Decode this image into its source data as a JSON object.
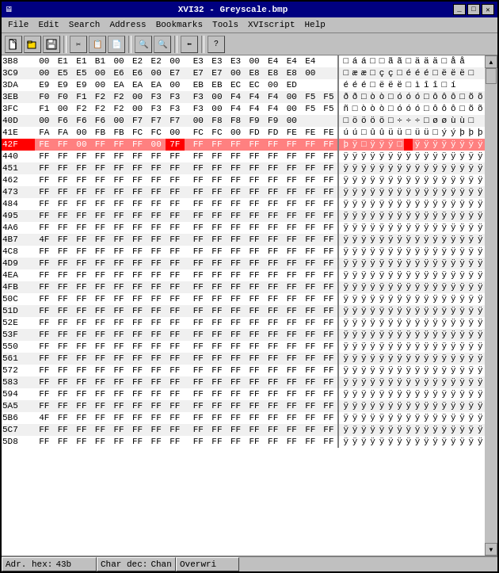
{
  "title": "XVI32 - Greyscale.bmp",
  "titleButtons": [
    "_",
    "□",
    "✕"
  ],
  "menu": [
    "File",
    "Edit",
    "Search",
    "Address",
    "Bookmarks",
    "Tools",
    "XVIscript",
    "Help"
  ],
  "toolbar": {
    "buttons": [
      "📄",
      "📂",
      "💾",
      "✂",
      "📋",
      "📄",
      "🔍",
      "🔍",
      "⬅",
      "?"
    ]
  },
  "rows": [
    {
      "addr": "3B8",
      "hex": [
        "00",
        "E1",
        "E1",
        "B1",
        "00",
        "E2",
        "E2",
        "00",
        "E3",
        "E3",
        "E3",
        "00",
        "E4",
        "E4",
        "E4"
      ],
      "chars": "□áá□□ãã□äää□åå"
    },
    {
      "addr": "3C9",
      "hex": [
        "00",
        "E5",
        "E5",
        "00",
        "E6",
        "E6",
        "00",
        "E7",
        "E7",
        "E7",
        "00",
        "E8",
        "E8",
        "E8",
        "00"
      ],
      "chars": "□ææ□çç□ééé□ëëë□"
    },
    {
      "addr": "3DA",
      "hex": [
        "E9",
        "E9",
        "E9",
        "00",
        "EA",
        "EA",
        "EA",
        "00",
        "EB",
        "EB",
        "EC",
        "EC",
        "00",
        "ED"
      ],
      "chars": "ééé□ëëë□ìîî□í"
    },
    {
      "addr": "3EB",
      "hex": [
        "F0",
        "F0",
        "F1",
        "F2",
        "F2",
        "00",
        "F3",
        "F3",
        "F3",
        "00",
        "F4",
        "F4",
        "F4",
        "00",
        "F5",
        "F5"
      ],
      "chars": "ðð□òò□óóó□ôôô□õõ"
    },
    {
      "addr": "3FC",
      "hex": [
        "F1",
        "00",
        "F2",
        "F2",
        "F2",
        "00",
        "F3",
        "F3",
        "F3",
        "00",
        "F4",
        "F4",
        "F4",
        "00",
        "F5",
        "F5"
      ],
      "chars": "ñ□òòò□óóó□ôôô□õõ"
    },
    {
      "addr": "40D",
      "hex": [
        "00",
        "F6",
        "F6",
        "F6",
        "00",
        "F7",
        "F7",
        "F7",
        "00",
        "F8",
        "F8",
        "F9",
        "F9",
        "00"
      ],
      "chars": "□öööö□÷÷÷□øøùù□"
    },
    {
      "addr": "41E",
      "hex": [
        "FA",
        "FA",
        "00",
        "FB",
        "FB",
        "FC",
        "FC",
        "00",
        "FC",
        "FC",
        "00",
        "FD",
        "FD",
        "FE",
        "FE",
        "FE"
      ],
      "chars": "úú□ûûüü□üü□ýýþþþ"
    },
    {
      "addr": "42F",
      "hex": [
        "FE",
        "FF",
        "00",
        "FF",
        "FF",
        "FF",
        "00",
        "7F",
        "FF",
        "FF",
        "FF",
        "FF",
        "FF",
        "FF",
        "FF",
        "FF"
      ],
      "chars": "þÿ□ÿÿÿ□ÿÿÿÿÿÿÿÿ",
      "highlight": true,
      "redCell": 7
    },
    {
      "addr": "440",
      "hex": [
        "FF",
        "FF",
        "FF",
        "FF",
        "FF",
        "FF",
        "FF",
        "FF",
        "FF",
        "FF",
        "FF",
        "FF",
        "FF",
        "FF",
        "FF",
        "FF"
      ],
      "chars": "ÿÿÿÿÿÿÿÿÿÿÿÿÿÿÿÿ"
    },
    {
      "addr": "451",
      "hex": [
        "FF",
        "FF",
        "FF",
        "FF",
        "FF",
        "FF",
        "FF",
        "FF",
        "FF",
        "FF",
        "FF",
        "FF",
        "FF",
        "FF",
        "FF",
        "FF"
      ],
      "chars": "ÿÿÿÿÿÿÿÿÿÿÿÿÿÿÿÿ"
    },
    {
      "addr": "462",
      "hex": [
        "FF",
        "FF",
        "FF",
        "FF",
        "FF",
        "FF",
        "FF",
        "FF",
        "FF",
        "FF",
        "FF",
        "FF",
        "FF",
        "FF",
        "FF",
        "FF"
      ],
      "chars": "ÿÿÿÿÿÿÿÿÿÿÿÿÿÿÿÿ"
    },
    {
      "addr": "473",
      "hex": [
        "FF",
        "FF",
        "FF",
        "FF",
        "FF",
        "FF",
        "FF",
        "FF",
        "FF",
        "FF",
        "FF",
        "FF",
        "FF",
        "FF",
        "FF",
        "FF"
      ],
      "chars": "ÿÿÿÿÿÿÿÿÿÿÿÿÿÿÿÿ"
    },
    {
      "addr": "484",
      "hex": [
        "FF",
        "FF",
        "FF",
        "FF",
        "FF",
        "FF",
        "FF",
        "FF",
        "FF",
        "FF",
        "FF",
        "FF",
        "FF",
        "FF",
        "FF",
        "FF"
      ],
      "chars": "ÿÿÿÿÿÿÿÿÿÿÿÿÿÿÿÿ"
    },
    {
      "addr": "495",
      "hex": [
        "FF",
        "FF",
        "FF",
        "FF",
        "FF",
        "FF",
        "FF",
        "FF",
        "FF",
        "FF",
        "FF",
        "FF",
        "FF",
        "FF",
        "FF",
        "FF"
      ],
      "chars": "ÿÿÿÿÿÿÿÿÿÿÿÿÿÿÿÿ"
    },
    {
      "addr": "4A6",
      "hex": [
        "FF",
        "FF",
        "FF",
        "FF",
        "FF",
        "FF",
        "FF",
        "FF",
        "FF",
        "FF",
        "FF",
        "FF",
        "FF",
        "FF",
        "FF",
        "FF"
      ],
      "chars": "ÿÿÿÿÿÿÿÿÿÿÿÿÿÿÿÿ"
    },
    {
      "addr": "4B7",
      "hex": [
        "4F",
        "FF",
        "FF",
        "FF",
        "FF",
        "FF",
        "FF",
        "FF",
        "FF",
        "FF",
        "FF",
        "FF",
        "FF",
        "FF",
        "FF",
        "FF"
      ],
      "chars": "ÿÿÿÿÿÿÿÿÿÿÿÿÿÿÿÿ"
    },
    {
      "addr": "4C8",
      "hex": [
        "FF",
        "FF",
        "FF",
        "FF",
        "FF",
        "FF",
        "FF",
        "FF",
        "FF",
        "FF",
        "FF",
        "FF",
        "FF",
        "FF",
        "FF",
        "FF"
      ],
      "chars": "ÿÿÿÿÿÿÿÿÿÿÿÿÿÿÿÿ"
    },
    {
      "addr": "4D9",
      "hex": [
        "FF",
        "FF",
        "FF",
        "FF",
        "FF",
        "FF",
        "FF",
        "FF",
        "FF",
        "FF",
        "FF",
        "FF",
        "FF",
        "FF",
        "FF",
        "FF"
      ],
      "chars": "ÿÿÿÿÿÿÿÿÿÿÿÿÿÿÿÿ"
    },
    {
      "addr": "4EA",
      "hex": [
        "FF",
        "FF",
        "FF",
        "FF",
        "FF",
        "FF",
        "FF",
        "FF",
        "FF",
        "FF",
        "FF",
        "FF",
        "FF",
        "FF",
        "FF",
        "FF"
      ],
      "chars": "ÿÿÿÿÿÿÿÿÿÿÿÿÿÿÿÿ"
    },
    {
      "addr": "4FB",
      "hex": [
        "FF",
        "FF",
        "FF",
        "FF",
        "FF",
        "FF",
        "FF",
        "FF",
        "FF",
        "FF",
        "FF",
        "FF",
        "FF",
        "FF",
        "FF",
        "FF"
      ],
      "chars": "ÿÿÿÿÿÿÿÿÿÿÿÿÿÿÿÿ"
    },
    {
      "addr": "50C",
      "hex": [
        "FF",
        "FF",
        "FF",
        "FF",
        "FF",
        "FF",
        "FF",
        "FF",
        "FF",
        "FF",
        "FF",
        "FF",
        "FF",
        "FF",
        "FF",
        "FF"
      ],
      "chars": "ÿÿÿÿÿÿÿÿÿÿÿÿÿÿÿÿ"
    },
    {
      "addr": "51D",
      "hex": [
        "FF",
        "FF",
        "FF",
        "FF",
        "FF",
        "FF",
        "FF",
        "FF",
        "FF",
        "FF",
        "FF",
        "FF",
        "FF",
        "FF",
        "FF",
        "FF"
      ],
      "chars": "ÿÿÿÿÿÿÿÿÿÿÿÿÿÿÿÿ"
    },
    {
      "addr": "52E",
      "hex": [
        "FF",
        "FF",
        "FF",
        "FF",
        "FF",
        "FF",
        "FF",
        "FF",
        "FF",
        "FF",
        "FF",
        "FF",
        "FF",
        "FF",
        "FF",
        "FF"
      ],
      "chars": "ÿÿÿÿÿÿÿÿÿÿÿÿÿÿÿÿ"
    },
    {
      "addr": "53F",
      "hex": [
        "FF",
        "FF",
        "FF",
        "FF",
        "FF",
        "FF",
        "FF",
        "FF",
        "FF",
        "FF",
        "FF",
        "FF",
        "FF",
        "FF",
        "FF",
        "FF"
      ],
      "chars": "ÿÿÿÿÿÿÿÿÿÿÿÿÿÿÿÿ"
    },
    {
      "addr": "550",
      "hex": [
        "FF",
        "FF",
        "FF",
        "FF",
        "FF",
        "FF",
        "FF",
        "FF",
        "FF",
        "FF",
        "FF",
        "FF",
        "FF",
        "FF",
        "FF",
        "FF"
      ],
      "chars": "ÿÿÿÿÿÿÿÿÿÿÿÿÿÿÿÿ"
    },
    {
      "addr": "561",
      "hex": [
        "FF",
        "FF",
        "FF",
        "FF",
        "FF",
        "FF",
        "FF",
        "FF",
        "FF",
        "FF",
        "FF",
        "FF",
        "FF",
        "FF",
        "FF",
        "FF"
      ],
      "chars": "ÿÿÿÿÿÿÿÿÿÿÿÿÿÿÿÿ"
    },
    {
      "addr": "572",
      "hex": [
        "FF",
        "FF",
        "FF",
        "FF",
        "FF",
        "FF",
        "FF",
        "FF",
        "FF",
        "FF",
        "FF",
        "FF",
        "FF",
        "FF",
        "FF",
        "FF"
      ],
      "chars": "ÿÿÿÿÿÿÿÿÿÿÿÿÿÿÿÿ"
    },
    {
      "addr": "583",
      "hex": [
        "FF",
        "FF",
        "FF",
        "FF",
        "FF",
        "FF",
        "FF",
        "FF",
        "FF",
        "FF",
        "FF",
        "FF",
        "FF",
        "FF",
        "FF",
        "FF"
      ],
      "chars": "ÿÿÿÿÿÿÿÿÿÿÿÿÿÿÿÿ"
    },
    {
      "addr": "594",
      "hex": [
        "FF",
        "FF",
        "FF",
        "FF",
        "FF",
        "FF",
        "FF",
        "FF",
        "FF",
        "FF",
        "FF",
        "FF",
        "FF",
        "FF",
        "FF",
        "FF"
      ],
      "chars": "ÿÿÿÿÿÿÿÿÿÿÿÿÿÿÿÿ"
    },
    {
      "addr": "5A5",
      "hex": [
        "FF",
        "FF",
        "FF",
        "FF",
        "FF",
        "FF",
        "FF",
        "FF",
        "FF",
        "FF",
        "FF",
        "FF",
        "FF",
        "FF",
        "FF",
        "FF"
      ],
      "chars": "ÿÿÿÿÿÿÿÿÿÿÿÿÿÿÿÿ"
    },
    {
      "addr": "5B6",
      "hex": [
        "4F",
        "FF",
        "FF",
        "FF",
        "FF",
        "FF",
        "FF",
        "FF",
        "FF",
        "FF",
        "FF",
        "FF",
        "FF",
        "FF",
        "FF",
        "FF"
      ],
      "chars": "ÿÿÿÿÿÿÿÿÿÿÿÿÿÿÿÿ"
    },
    {
      "addr": "5C7",
      "hex": [
        "FF",
        "FF",
        "FF",
        "FF",
        "FF",
        "FF",
        "FF",
        "FF",
        "FF",
        "FF",
        "FF",
        "FF",
        "FF",
        "FF",
        "FF",
        "FF"
      ],
      "chars": "ÿÿÿÿÿÿÿÿÿÿÿÿÿÿÿÿ"
    },
    {
      "addr": "5D8",
      "hex": [
        "FF",
        "FF",
        "FF",
        "FF",
        "FF",
        "FF",
        "FF",
        "FF",
        "FF",
        "FF",
        "FF",
        "FF",
        "FF",
        "FF",
        "FF",
        "FF"
      ],
      "chars": "ÿÿÿÿÿÿÿÿÿÿÿÿÿÿÿÿ"
    }
  ],
  "statusBar": {
    "addrLabel": "Adr. hex:",
    "addrValue": "43b",
    "charLabel": "Char dec:",
    "charValue": "Chan",
    "modeLabel": "Overwri"
  }
}
